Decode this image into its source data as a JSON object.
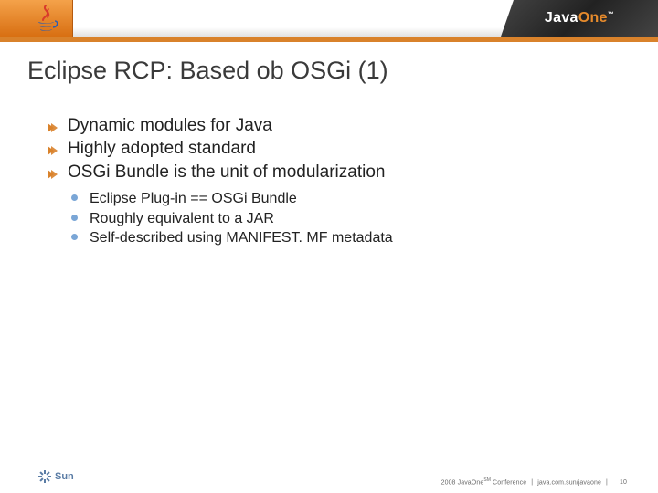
{
  "header": {
    "brand_prefix": "Java",
    "brand_accent": "One",
    "tm": "™"
  },
  "title": "Eclipse RCP: Based ob OSGi (1)",
  "bullets": {
    "l1": [
      "Dynamic modules for Java",
      "Highly adopted standard",
      "OSGi Bundle is the unit of modularization"
    ],
    "l2": [
      "Eclipse Plug-in == OSGi Bundle",
      "Roughly equivalent to a JAR",
      "Self-described using MANIFEST. MF metadata"
    ]
  },
  "footer": {
    "sun": "Sun",
    "conf": "2008 JavaOne",
    "conf_suffix": " Conference",
    "sm": "SM",
    "url": "java.com.sun/javaone",
    "sep": "|",
    "page": "10"
  }
}
